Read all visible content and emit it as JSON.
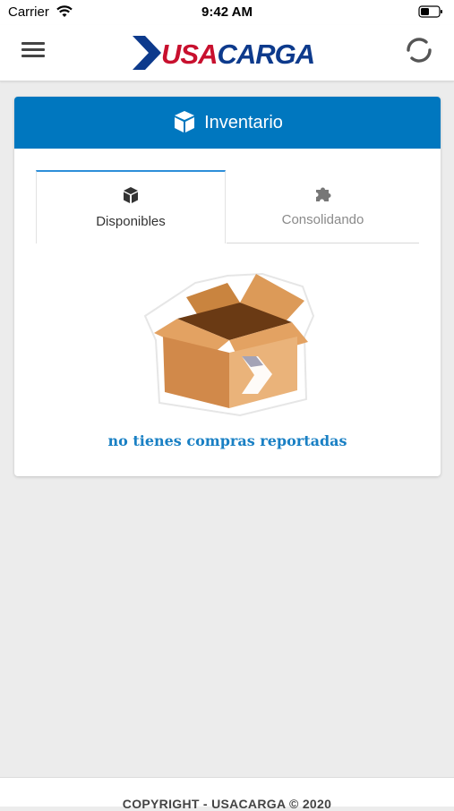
{
  "status_bar": {
    "carrier": "Carrier",
    "time": "9:42 AM"
  },
  "header": {
    "logo_text": "USACARGA",
    "menu_icon": "hamburger-menu-icon",
    "refresh_icon": "refresh-icon"
  },
  "card": {
    "title": "Inventario",
    "title_icon": "cube-icon",
    "tabs": [
      {
        "label": "Disponibles",
        "icon": "cube-icon",
        "active": true
      },
      {
        "label": "Consolidando",
        "icon": "puzzle-icon",
        "active": false
      }
    ],
    "empty_message": "no tienes compras reportadas"
  },
  "footer": {
    "copyright": "COPYRIGHT - USACARGA © 2020"
  },
  "colors": {
    "primary": "#0077bf",
    "logo_red": "#c8102e",
    "logo_blue": "#0d3a8c",
    "message_blue": "#1a80c4",
    "background": "#ececec"
  }
}
